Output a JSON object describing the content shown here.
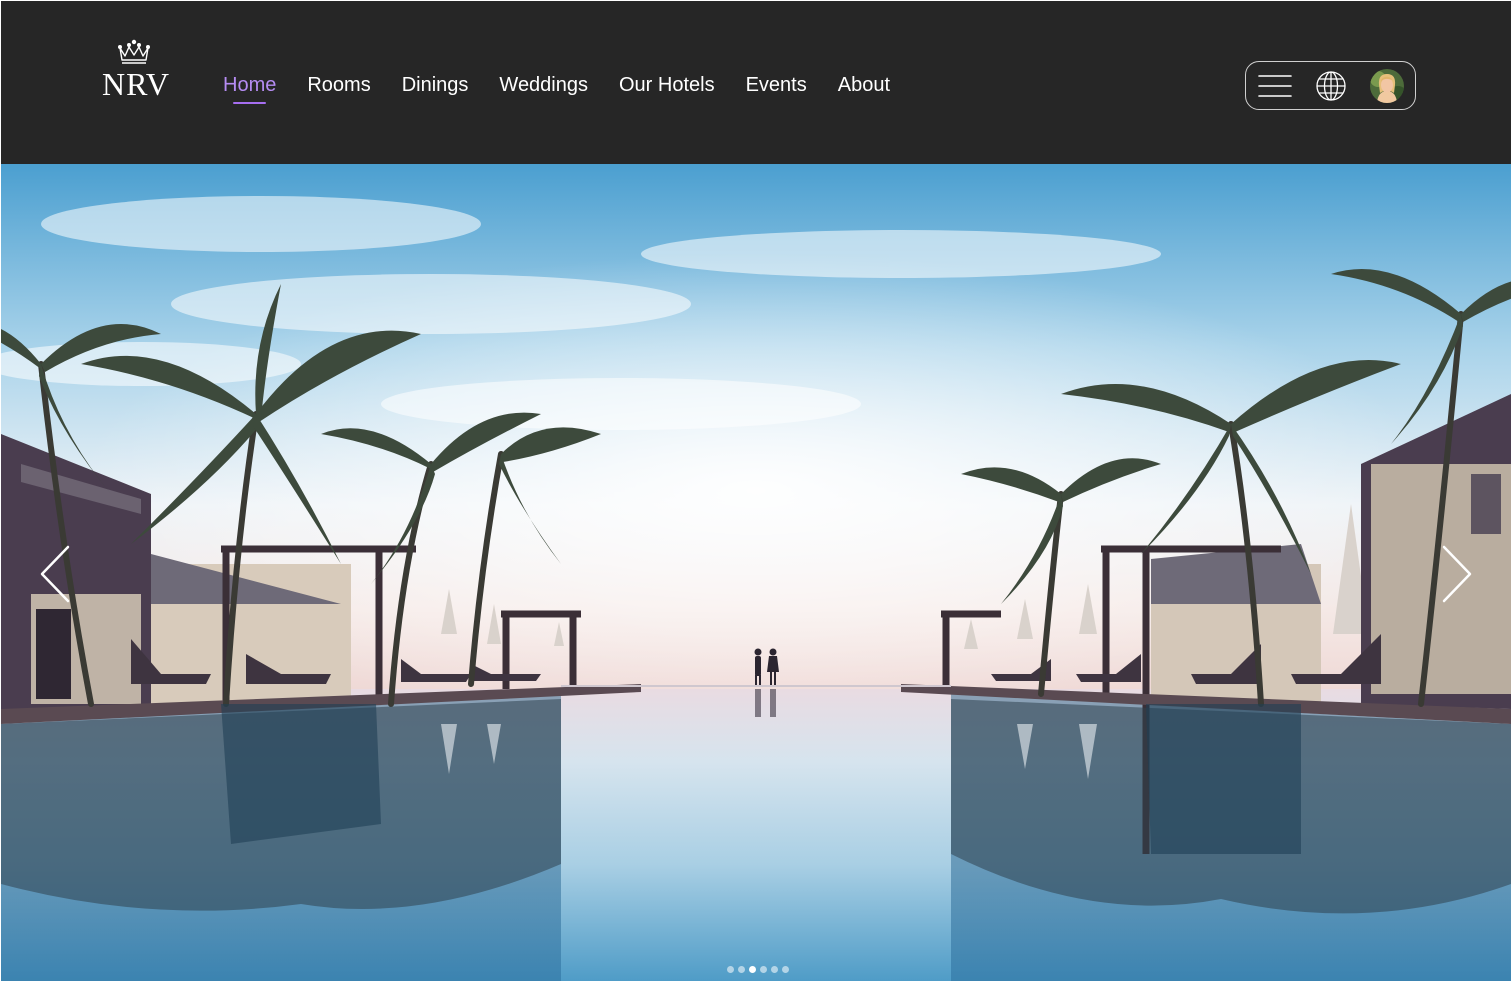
{
  "brand": {
    "name": "NRV",
    "logo_icon": "crown-icon"
  },
  "nav": {
    "items": [
      {
        "label": "Home",
        "active": true
      },
      {
        "label": "Rooms",
        "active": false
      },
      {
        "label": "Dinings",
        "active": false
      },
      {
        "label": "Weddings",
        "active": false
      },
      {
        "label": "Our Hotels",
        "active": false
      },
      {
        "label": "Events",
        "active": false
      },
      {
        "label": "About",
        "active": false
      }
    ]
  },
  "user_menu": {
    "icons": [
      "hamburger-menu-icon",
      "globe-icon",
      "user-avatar"
    ]
  },
  "hero": {
    "image": "resort-infinity-pool-with-palm-trees-and-couple-at-sunset",
    "prev_icon": "chevron-left-icon",
    "next_icon": "chevron-right-icon",
    "slide_count": 6,
    "active_slide": 3
  },
  "colors": {
    "header_bg": "#262626",
    "nav_text": "#ffffff",
    "nav_active": "#b58cf2",
    "nav_active_underline": "#a66ef0",
    "pill_border": "#d0d0d0"
  }
}
